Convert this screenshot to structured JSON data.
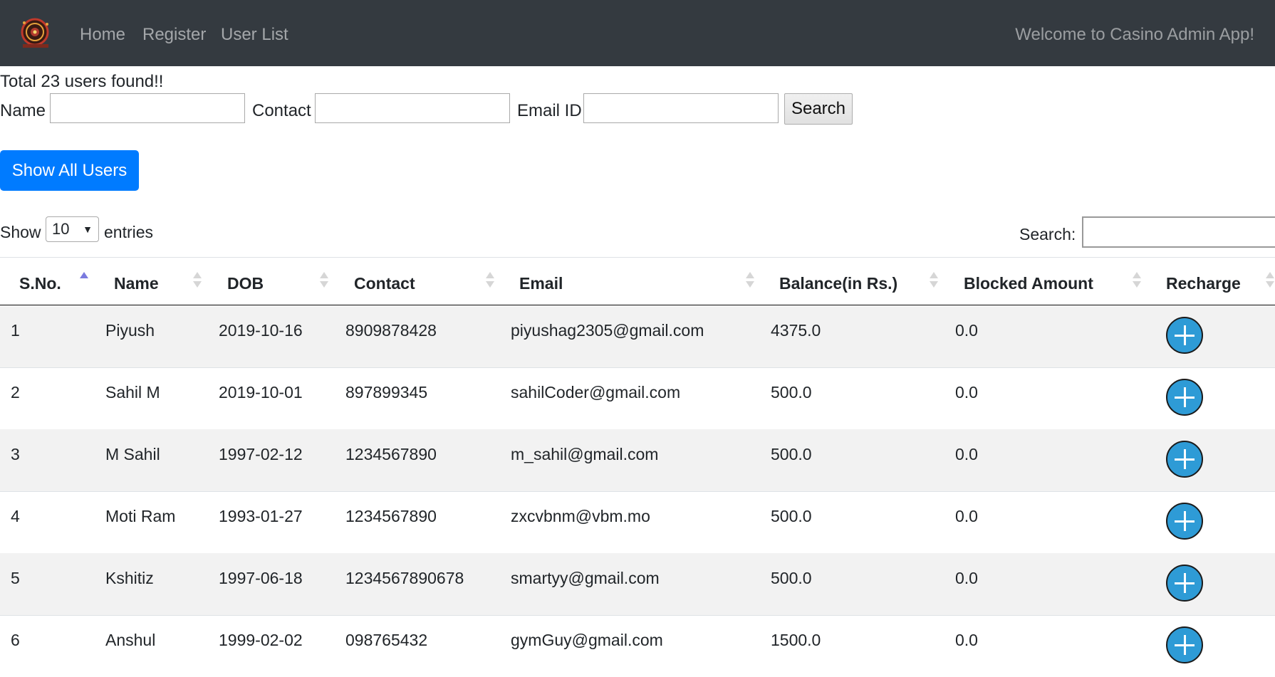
{
  "nav": {
    "logo": "casino-roulette-logo",
    "links": [
      "Home",
      "Register",
      "User List"
    ],
    "welcome": "Welcome to Casino Admin App!"
  },
  "summary": {
    "total_text": "Total 23 users found!!"
  },
  "filters": {
    "name_label": "Name",
    "contact_label": "Contact",
    "email_label": "Email ID",
    "name_value": "",
    "contact_value": "",
    "email_value": "",
    "search_button": "Search"
  },
  "show_all_button": "Show All Users",
  "table_controls": {
    "show_label": "Show",
    "entries_value": "10",
    "entries_label": "entries",
    "search_label": "Search:",
    "search_value": ""
  },
  "table": {
    "columns": [
      "S.No.",
      "Name",
      "DOB",
      "Contact",
      "Email",
      "Balance(in Rs.)",
      "Blocked Amount",
      "Recharge"
    ],
    "sorted_column": "S.No.",
    "rows": [
      {
        "sno": "1",
        "name": "Piyush",
        "dob": "2019-10-16",
        "contact": "8909878428",
        "email": "piyushag2305@gmail.com",
        "balance": "4375.0",
        "blocked": "0.0"
      },
      {
        "sno": "2",
        "name": "Sahil M",
        "dob": "2019-10-01",
        "contact": "897899345",
        "email": "sahilCoder@gmail.com",
        "balance": "500.0",
        "blocked": "0.0"
      },
      {
        "sno": "3",
        "name": "M Sahil",
        "dob": "1997-02-12",
        "contact": "1234567890",
        "email": "m_sahil@gmail.com",
        "balance": "500.0",
        "blocked": "0.0"
      },
      {
        "sno": "4",
        "name": "Moti Ram",
        "dob": "1993-01-27",
        "contact": "1234567890",
        "email": "zxcvbnm@vbm.mo",
        "balance": "500.0",
        "blocked": "0.0"
      },
      {
        "sno": "5",
        "name": "Kshitiz",
        "dob": "1997-06-18",
        "contact": "1234567890678",
        "email": "smartyy@gmail.com",
        "balance": "500.0",
        "blocked": "0.0"
      },
      {
        "sno": "6",
        "name": "Anshul",
        "dob": "1999-02-02",
        "contact": "098765432",
        "email": "gymGuy@gmail.com",
        "balance": "1500.0",
        "blocked": "0.0"
      }
    ]
  },
  "colors": {
    "navbar": "#343a40",
    "primary": "#007bff",
    "recharge": "#2e9bd6",
    "stripe": "#f2f2f2"
  }
}
